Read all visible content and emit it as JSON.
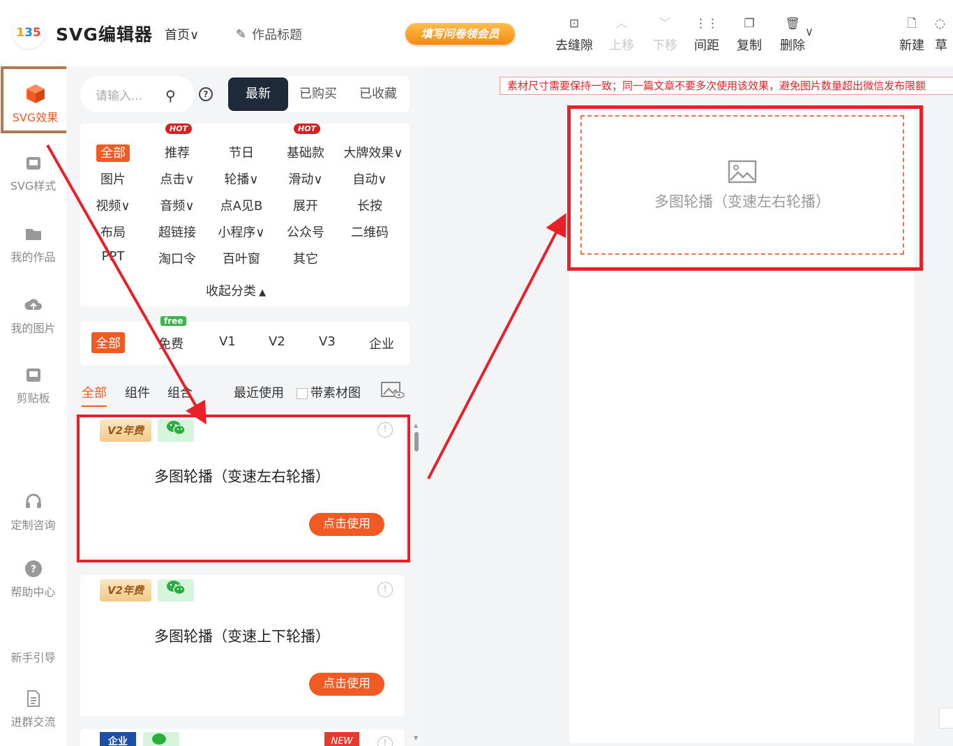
{
  "header": {
    "logo_text": "135",
    "app_title": "SVG编辑器",
    "nav_home": "首页∨",
    "work_title_placeholder": "作品标题",
    "promo_label": "填写问卷领会员",
    "toolbar": [
      {
        "label": "去缝隙",
        "icon": "gap-icon",
        "disabled": false
      },
      {
        "label": "上移",
        "icon": "chevron-up-icon",
        "disabled": true
      },
      {
        "label": "下移",
        "icon": "chevron-down-icon",
        "disabled": true
      },
      {
        "label": "间距",
        "icon": "spacing-icon",
        "disabled": false
      },
      {
        "label": "复制",
        "icon": "copy-icon",
        "disabled": false
      },
      {
        "label": "删除",
        "icon": "trash-icon",
        "disabled": false
      },
      {
        "label": "新建",
        "icon": "new-file-icon",
        "disabled": false
      },
      {
        "label": "草",
        "icon": "draft-icon",
        "disabled": false
      }
    ]
  },
  "rail": {
    "items": [
      {
        "label": "SVG效果",
        "icon": "cube-icon",
        "active": true
      },
      {
        "label": "SVG样式",
        "icon": "style-icon",
        "active": false
      },
      {
        "label": "我的作品",
        "icon": "folder-icon",
        "active": false
      },
      {
        "label": "我的图片",
        "icon": "cloud-icon",
        "active": false
      },
      {
        "label": "剪贴板",
        "icon": "clipboard-icon",
        "active": false
      },
      {
        "label": "定制咨询",
        "icon": "headset-icon",
        "active": false
      },
      {
        "label": "帮助中心",
        "icon": "help-icon",
        "active": false
      },
      {
        "label": "新手引导",
        "icon": "guide-icon",
        "active": false
      },
      {
        "label": "进群交流",
        "icon": "doc-icon",
        "active": false
      }
    ]
  },
  "sidebar": {
    "search_placeholder": "请输入...",
    "help_glyph": "?",
    "tabs": [
      "最新",
      "已购买",
      "已收藏"
    ],
    "active_tab": "最新",
    "categories": {
      "rows": [
        [
          "全部",
          "推荐",
          "节日",
          "基础款",
          "大牌效果∨"
        ],
        [
          "图片",
          "点击∨",
          "轮播∨",
          "滑动∨",
          "自动∨"
        ],
        [
          "视频∨",
          "音频∨",
          "点A见B",
          "展开",
          "长按"
        ],
        [
          "布局",
          "超链接",
          "小程序∨",
          "公众号",
          "二维码"
        ],
        [
          "PPT",
          "淘口令",
          "百叶窗",
          "其它"
        ]
      ],
      "hot_label": "HOT",
      "collapse_label": "收起分类"
    },
    "tiers": [
      "全部",
      "免费",
      "V1",
      "V2",
      "V3",
      "企业"
    ],
    "free_badge": "free",
    "filters": {
      "tabs": [
        "全部",
        "组件",
        "组合"
      ],
      "recent": "最近使用",
      "with_material": "带素材图"
    },
    "cards": [
      {
        "badge": "V2年费",
        "title": "多图轮播（变速左右轮播）",
        "button": "点击使用"
      },
      {
        "badge": "V2年费",
        "title": "多图轮播（变速上下轮播）",
        "button": "点击使用"
      },
      {
        "badge": "企业",
        "title": "",
        "button": "",
        "new_badge": "NEW"
      }
    ]
  },
  "canvas": {
    "notice": "素材尺寸需要保持一致；同一篇文章不要多次使用该效果，避免图片数量超出微信发布限额",
    "placeholder_title": "多图轮播（变速左右轮播）"
  },
  "colors": {
    "accent": "#f15a22",
    "annotation_red": "#e8202a",
    "dark_tab": "#1e2a3a"
  }
}
